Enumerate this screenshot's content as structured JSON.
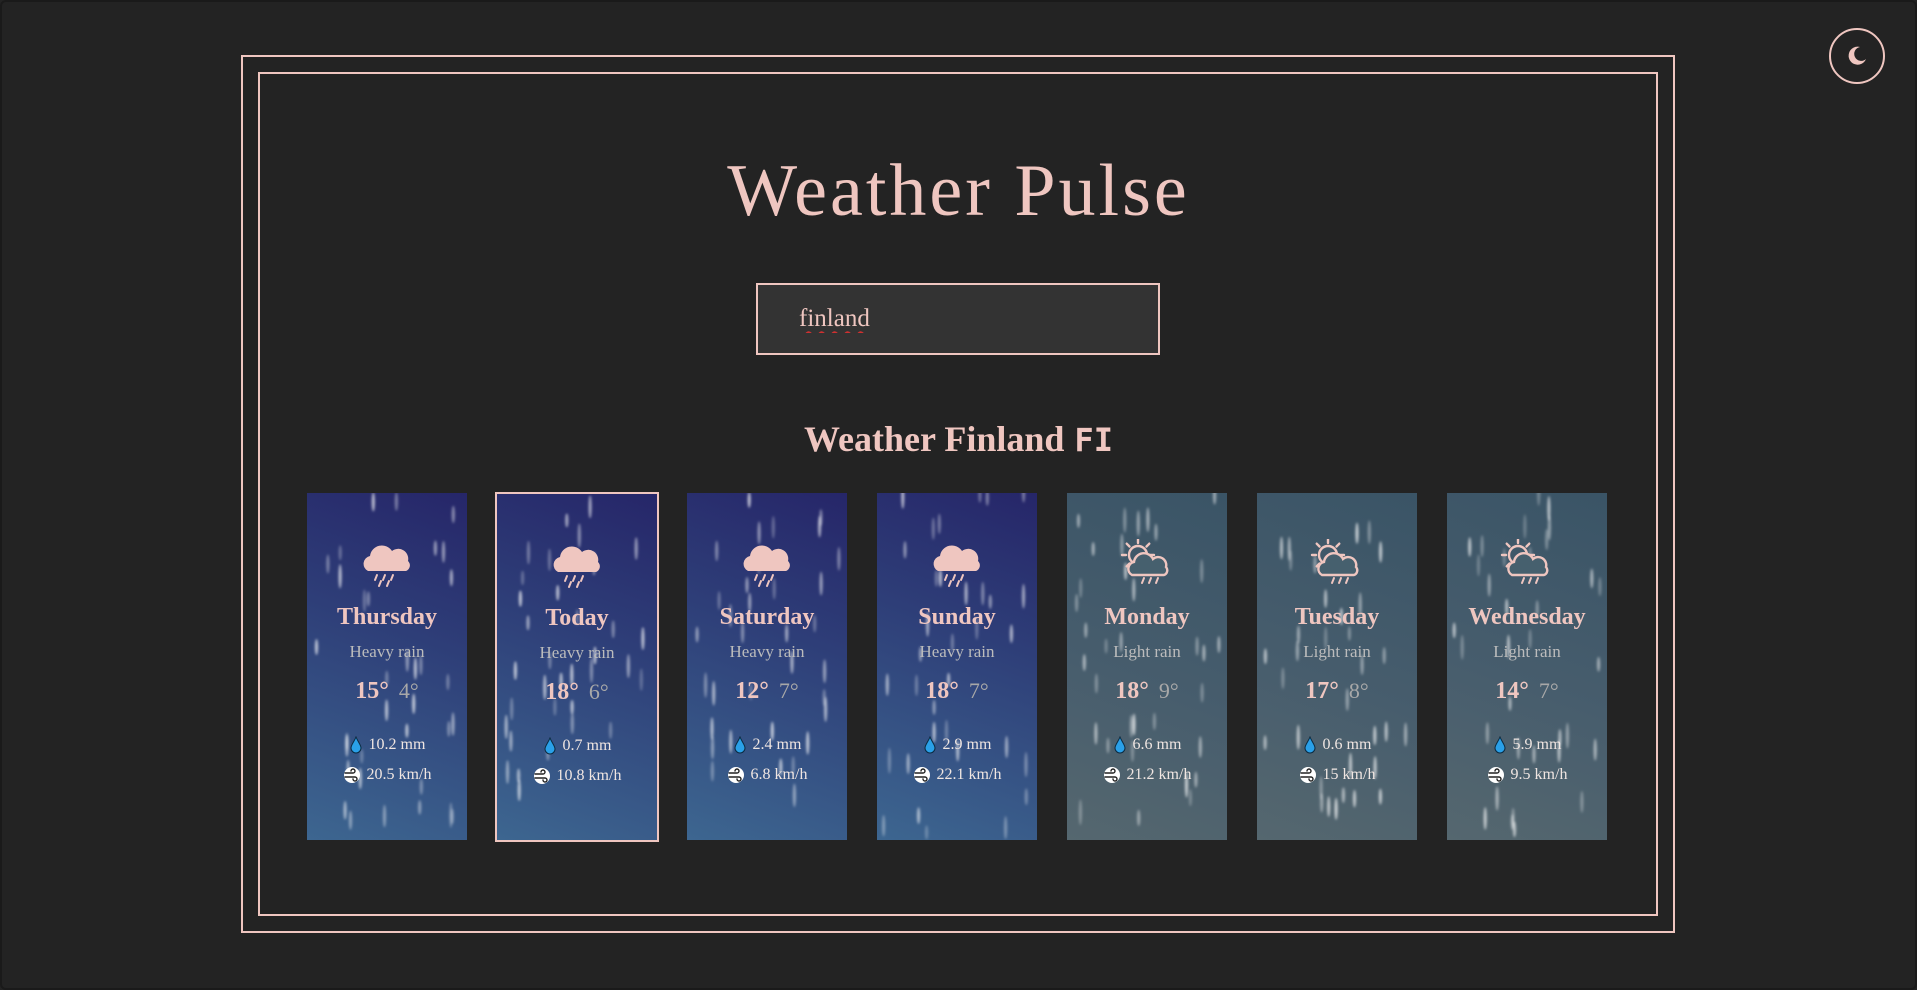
{
  "app": {
    "title": "Weather Pulse"
  },
  "search": {
    "value": "finland"
  },
  "location": {
    "heading": "Weather Finland",
    "country_code": "FI"
  },
  "forecast": [
    {
      "day": "Thursday",
      "condition": "Heavy rain",
      "high": "15°",
      "low": "4°",
      "precip": "10.2 mm",
      "wind": "20.5 km/h",
      "icon": "rain-cloud-icon",
      "style": "heavy",
      "selected": false
    },
    {
      "day": "Today",
      "condition": "Heavy rain",
      "high": "18°",
      "low": "6°",
      "precip": "0.7 mm",
      "wind": "10.8 km/h",
      "icon": "rain-cloud-icon",
      "style": "heavy",
      "selected": true
    },
    {
      "day": "Saturday",
      "condition": "Heavy rain",
      "high": "12°",
      "low": "7°",
      "precip": "2.4 mm",
      "wind": "6.8 km/h",
      "icon": "rain-cloud-icon",
      "style": "heavy",
      "selected": false
    },
    {
      "day": "Sunday",
      "condition": "Heavy rain",
      "high": "18°",
      "low": "7°",
      "precip": "2.9 mm",
      "wind": "22.1 km/h",
      "icon": "rain-cloud-icon",
      "style": "heavy",
      "selected": false
    },
    {
      "day": "Monday",
      "condition": "Light rain",
      "high": "18°",
      "low": "9°",
      "precip": "6.6 mm",
      "wind": "21.2 km/h",
      "icon": "sun-rain-cloud-icon",
      "style": "light",
      "selected": false
    },
    {
      "day": "Tuesday",
      "condition": "Light rain",
      "high": "17°",
      "low": "8°",
      "precip": "0.6 mm",
      "wind": "15 km/h",
      "icon": "sun-rain-cloud-icon",
      "style": "light",
      "selected": false
    },
    {
      "day": "Wednesday",
      "condition": "Light rain",
      "high": "14°",
      "low": "7°",
      "precip": "5.9 mm",
      "wind": "9.5 km/h",
      "icon": "sun-rain-cloud-icon",
      "style": "light",
      "selected": false
    }
  ],
  "colors": {
    "accent": "#efc6c0",
    "background": "#232323",
    "search_bg": "#333333",
    "heavy_card": "#2e3e78",
    "light_card": "#475d6d",
    "drop": "#2aa0e8"
  },
  "icons": {
    "theme_toggle": "moon-icon",
    "precip": "water-drop-icon",
    "wind": "wind-icon"
  }
}
